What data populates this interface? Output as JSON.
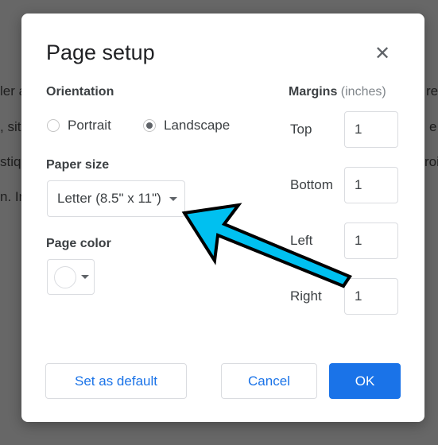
{
  "background_text": {
    "left": [
      "ler a",
      ", sit",
      "stiq",
      "n. In"
    ],
    "right": [
      "re",
      "e",
      "roi"
    ]
  },
  "dialog": {
    "title": "Page setup",
    "close_icon": "close-icon",
    "orientation": {
      "label": "Orientation",
      "options": [
        {
          "label": "Portrait",
          "selected": false
        },
        {
          "label": "Landscape",
          "selected": true
        }
      ]
    },
    "paper_size": {
      "label": "Paper size",
      "value": "Letter (8.5\" x 11\")"
    },
    "page_color": {
      "label": "Page color",
      "value": "#ffffff"
    },
    "margins": {
      "label": "Margins",
      "unit": "(inches)",
      "fields": [
        {
          "label": "Top",
          "value": "1"
        },
        {
          "label": "Bottom",
          "value": "1"
        },
        {
          "label": "Left",
          "value": "1"
        },
        {
          "label": "Right",
          "value": "1"
        }
      ]
    },
    "buttons": {
      "set_default": "Set as default",
      "cancel": "Cancel",
      "ok": "OK"
    }
  },
  "annotation": {
    "type": "arrow",
    "color": "#00c0f0",
    "target": "paper-size-select"
  },
  "colors": {
    "accent": "#1a73e8",
    "overlay": "#676767"
  }
}
